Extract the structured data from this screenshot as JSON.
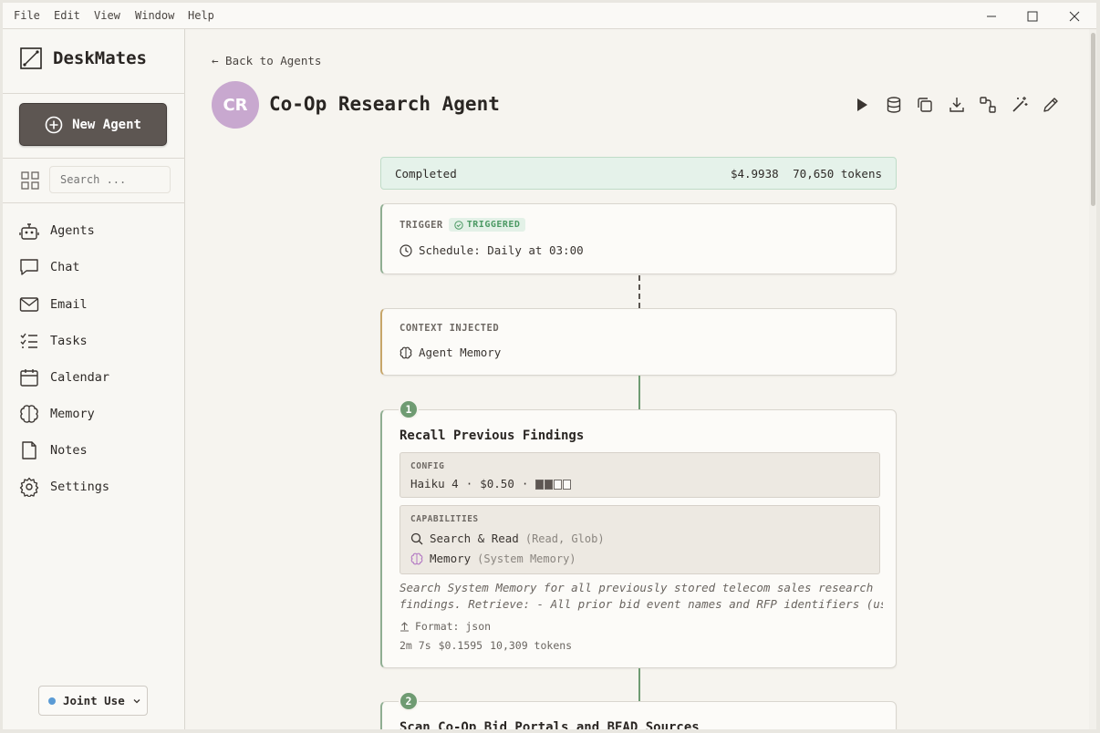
{
  "menu": [
    "File",
    "Edit",
    "View",
    "Window",
    "Help"
  ],
  "app": {
    "name": "DeskMates"
  },
  "sidebar": {
    "new_agent": "New Agent",
    "search_placeholder": "Search ...",
    "items": [
      {
        "label": "Agents",
        "icon": "agents-icon"
      },
      {
        "label": "Chat",
        "icon": "chat-icon"
      },
      {
        "label": "Email",
        "icon": "email-icon"
      },
      {
        "label": "Tasks",
        "icon": "tasks-icon"
      },
      {
        "label": "Calendar",
        "icon": "calendar-icon"
      },
      {
        "label": "Memory",
        "icon": "brain-icon"
      },
      {
        "label": "Notes",
        "icon": "note-icon"
      },
      {
        "label": "Settings",
        "icon": "gear-icon"
      }
    ],
    "mode": "Joint Use"
  },
  "header": {
    "back": "← Back to Agents",
    "avatar": "CR",
    "title": "Co-Op Research Agent"
  },
  "status": {
    "text": "Completed",
    "cost": "$4.9938",
    "tokens": "70,650 tokens"
  },
  "trigger": {
    "label": "TRIGGER",
    "badge": "TRIGGERED",
    "schedule": "Schedule: Daily at 03:00"
  },
  "context": {
    "label": "CONTEXT INJECTED",
    "item": "Agent Memory"
  },
  "step1": {
    "num": "1",
    "title": "Recall Previous Findings",
    "config_label": "CONFIG",
    "model": "Haiku 4",
    "sep": "·",
    "budget": "$0.50",
    "effort_level": 2,
    "effort_max": 4,
    "cap_label": "CAPABILITIES",
    "cap1": "Search & Read",
    "cap1_detail": "(Read, Glob)",
    "cap2": "Memory",
    "cap2_detail": "(System Memory)",
    "prompt_line1": "Search System Memory for all previously stored telecom sales research",
    "prompt_line2": "findings. Retrieve: - All prior bid event names and RFP identifiers (use…",
    "format": "Format: json",
    "duration": "2m 7s",
    "cost": "$0.1595",
    "tokens": "10,309 tokens"
  },
  "step2": {
    "num": "2",
    "title": "Scan Co-Op Bid Portals and BEAD Sources"
  },
  "colors": {
    "accent": "#5d5652",
    "success": "#6f9b72",
    "memory": "#b57cc4",
    "status_bg": "#e5f2ea",
    "avatar": "#c8a8cf",
    "mode_dot": "#5b9bd5"
  }
}
